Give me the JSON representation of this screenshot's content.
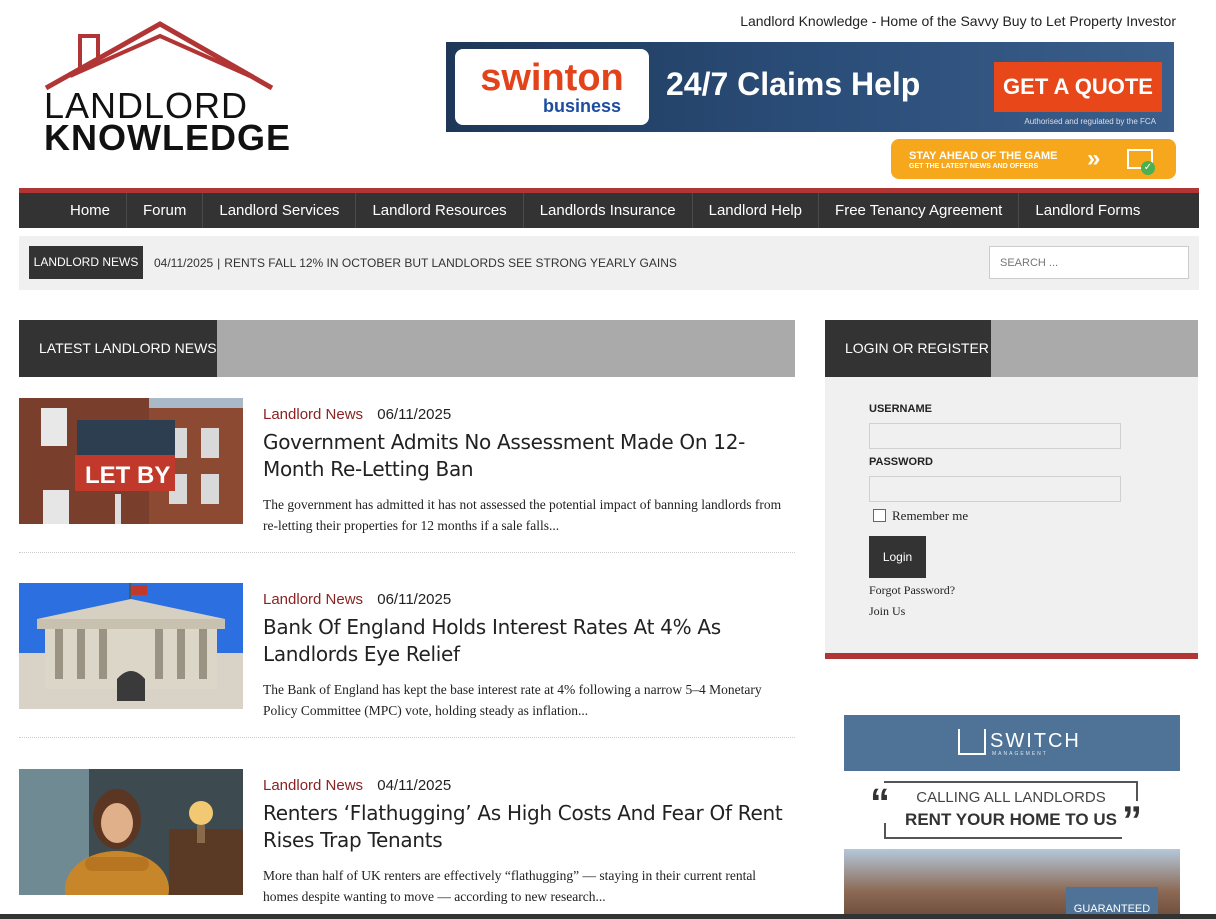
{
  "header": {
    "tagline": "Landlord Knowledge - Home of the Savvy Buy to Let Property Investor",
    "logo_line1": "LANDLORD",
    "logo_line2": "KNOWLEDGE"
  },
  "banner_ad": {
    "brand": "swinton",
    "brand_sub": "business",
    "headline": "24/7 Claims Help",
    "cta": "GET A QUOTE",
    "fine_print": "Authorised and regulated by the FCA"
  },
  "newsletter": {
    "line1": "STAY AHEAD OF THE GAME",
    "line2": "GET THE LATEST NEWS AND OFFERS",
    "arrows": "»"
  },
  "nav": {
    "items": [
      "Home",
      "Forum",
      "Landlord Services",
      "Landlord Resources",
      "Landlords Insurance",
      "Landlord Help",
      "Free Tenancy Agreement",
      "Landlord Forms"
    ]
  },
  "ticker": {
    "label": "LANDLORD NEWS",
    "date": "04/11/2025",
    "separator": "|",
    "headline": "RENTS FALL 12% IN OCTOBER BUT LANDLORDS SEE STRONG YEARLY GAINS",
    "search_placeholder": "SEARCH ..."
  },
  "main": {
    "section_title": "LATEST LANDLORD NEWS",
    "articles": [
      {
        "category": "Landlord News",
        "date": "06/11/2025",
        "title": "Government Admits No Assessment Made On 12-Month Re-Letting Ban",
        "excerpt": "The government has admitted it has not assessed the potential impact of banning landlords from re-letting their properties for 12 months if a sale falls...",
        "thumb_text": "LET BY"
      },
      {
        "category": "Landlord News",
        "date": "06/11/2025",
        "title": "Bank Of England Holds Interest Rates At 4% As Landlords Eye Relief",
        "excerpt": "The Bank of England has kept the base interest rate at 4% following a narrow 5–4 Monetary Policy Committee (MPC) vote, holding steady as inflation..."
      },
      {
        "category": "Landlord News",
        "date": "04/11/2025",
        "title": "Renters ‘Flathugging’ As High Costs And Fear Of Rent Rises Trap Tenants",
        "excerpt": "More than half of UK renters are effectively “flathugging” — staying in their current rental homes despite wanting to move — according to new research..."
      }
    ]
  },
  "sidebar": {
    "login_title": "LOGIN OR REGISTER",
    "username_label": "USERNAME",
    "password_label": "PASSWORD",
    "remember_label": "Remember me",
    "login_button": "Login",
    "forgot_link": "Forgot Password?",
    "join_link": "Join Us",
    "ad": {
      "brand": "SWITCH",
      "brand_sub": "MANAGEMENT",
      "line1": "CALLING ALL LANDLORDS",
      "line2": "RENT YOUR HOME TO US",
      "badge": "GUARANTEED"
    }
  },
  "colors": {
    "accent_red": "#b23535",
    "nav_dark": "#333333",
    "category_red": "#8a2323",
    "cta_orange": "#e8471a",
    "pill_orange": "#f7a71b",
    "switch_blue": "#4e7396"
  }
}
